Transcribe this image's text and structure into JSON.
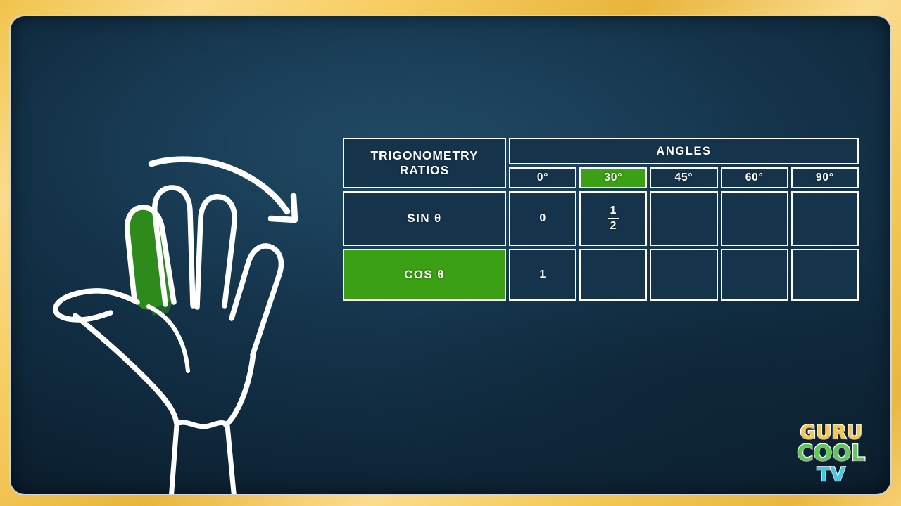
{
  "theme": {
    "frame_color": "#f0c34a",
    "board_color": "#123349",
    "accent_green": "#3ba014",
    "stroke_white": "#ffffff"
  },
  "illustration": {
    "name": "open-hand-with-curved-arrow",
    "highlighted_finger": "index-finger",
    "highlight_color": "#2e8b1b",
    "arrow_direction": "left-to-right-sweep"
  },
  "table": {
    "corner_label": "TRIGONOMETRY RATIOS",
    "group_header": "ANGLES",
    "angles": [
      "0°",
      "30°",
      "45°",
      "60°",
      "90°"
    ],
    "highlighted_angle_index": 1,
    "highlighted_row_index": 1,
    "rows": [
      {
        "label": "SIN θ",
        "values": [
          "0",
          "1/2",
          "",
          "",
          ""
        ],
        "value_display": [
          "0",
          "frac",
          "",
          "",
          ""
        ],
        "frac": {
          "numerator": "1",
          "denominator": "2"
        }
      },
      {
        "label": "COS θ",
        "values": [
          "1",
          "",
          "",
          "",
          ""
        ],
        "value_display": [
          "1",
          "",
          "",
          "",
          ""
        ]
      }
    ]
  },
  "logo": {
    "line1": "GURU",
    "line2": "COOL",
    "line3": "TV",
    "color1": "#f6c84f",
    "color2": "#5ec95a",
    "color3": "#3fc9ea"
  }
}
